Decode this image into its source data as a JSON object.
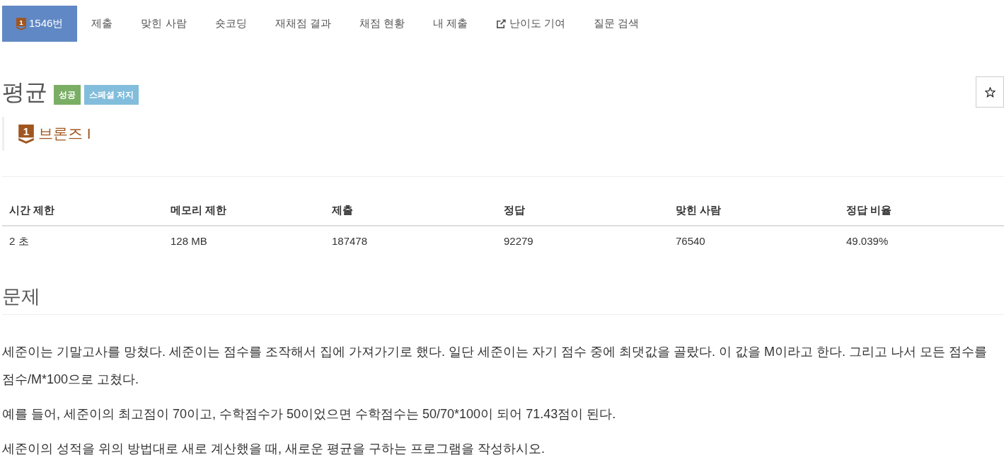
{
  "nav": {
    "tabs": [
      {
        "kind": "problem",
        "badge": "1",
        "label": "1546번",
        "selected": true
      },
      {
        "kind": "plain",
        "label": "제출",
        "selected": false
      },
      {
        "kind": "plain",
        "label": "맞힌 사람",
        "selected": false
      },
      {
        "kind": "plain",
        "label": "숏코딩",
        "selected": false
      },
      {
        "kind": "plain",
        "label": "재채점 결과",
        "selected": false
      },
      {
        "kind": "plain",
        "label": "채점 현황",
        "selected": false
      },
      {
        "kind": "plain",
        "label": "내 제출",
        "selected": false
      },
      {
        "kind": "external",
        "label": "난이도 기여",
        "selected": false
      },
      {
        "kind": "plain",
        "label": "질문 검색",
        "selected": false
      }
    ]
  },
  "problem": {
    "title": "평균",
    "labels": [
      {
        "text": "성공",
        "color": "#7aae65"
      },
      {
        "text": "스페셜 저지",
        "color": "#82bddb"
      }
    ],
    "tier": {
      "badge": "1",
      "label": "브론즈 I"
    }
  },
  "limits": {
    "columns": [
      "시간 제한",
      "메모리 제한",
      "제출",
      "정답",
      "맞힌 사람",
      "정답 비율"
    ],
    "rows": [
      [
        "2 초",
        "128 MB",
        "187478",
        "92279",
        "76540",
        "49.039%"
      ]
    ]
  },
  "statement": {
    "heading": "문제",
    "paragraphs": [
      "세준이는 기말고사를 망쳤다. 세준이는 점수를 조작해서 집에 가져가기로 했다. 일단 세준이는 자기 점수 중에 최댓값을 골랐다. 이 값을 M이라고 한다. 그리고 나서 모든 점수를 점수/M*100으로 고쳤다.",
      "예를 들어, 세준이의 최고점이 70이고, 수학점수가 50이었으면 수학점수는 50/70*100이 되어 71.43점이 된다.",
      "세준이의 성적을 위의 방법대로 새로 계산했을 때, 새로운 평균을 구하는 프로그램을 작성하시오."
    ]
  }
}
